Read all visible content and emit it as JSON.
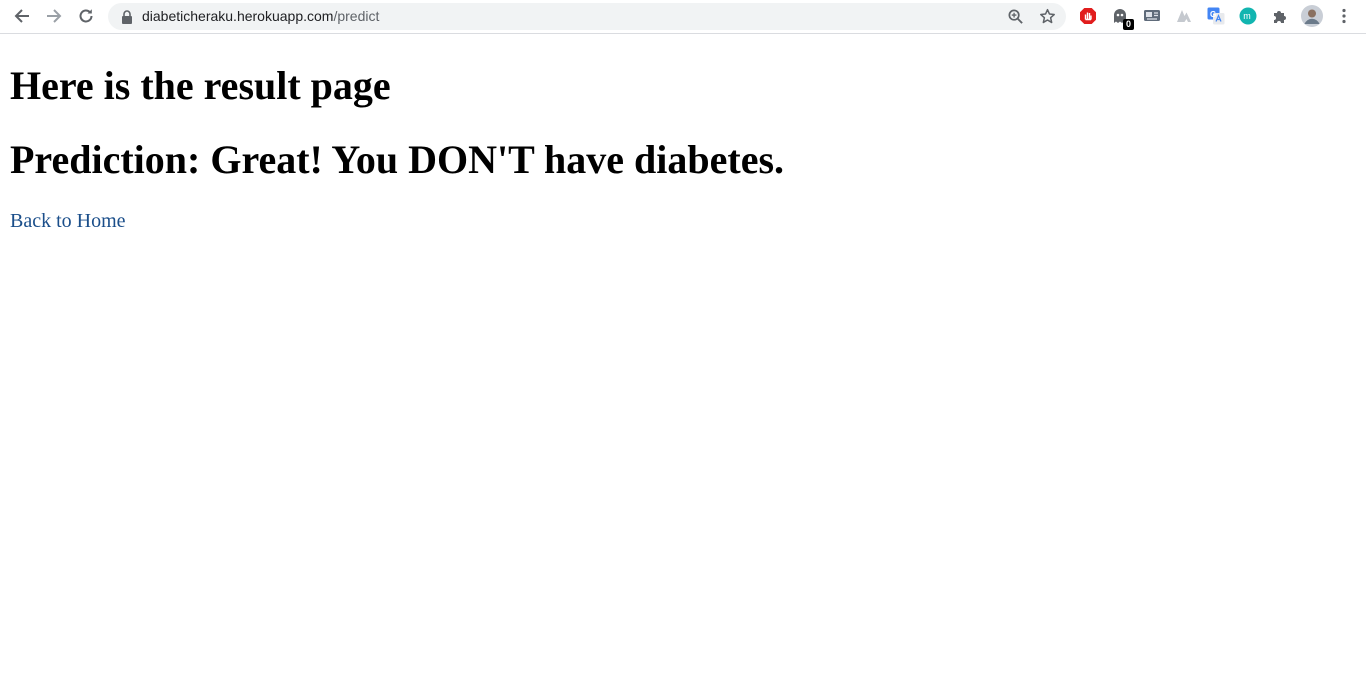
{
  "browser": {
    "url_host": "diabeticheraku.herokuapp.com",
    "url_path": "/predict",
    "extensions": [
      {
        "icon": "adblock-icon",
        "color": "#e11d1d"
      },
      {
        "icon": "ghostery-icon",
        "badge": "0"
      },
      {
        "icon": "id-card-extension-icon"
      },
      {
        "icon": "triangle-extension-icon"
      },
      {
        "icon": "google-translate-icon",
        "color": "#4285f4"
      },
      {
        "icon": "m-extension-icon",
        "color": "#12b5b0"
      },
      {
        "icon": "puzzle-icon"
      },
      {
        "icon": "profile-avatar"
      }
    ]
  },
  "page": {
    "heading": "Here is the result page",
    "prediction": "Prediction: Great! You DON'T have diabetes.",
    "link_text": "Back to Home"
  }
}
